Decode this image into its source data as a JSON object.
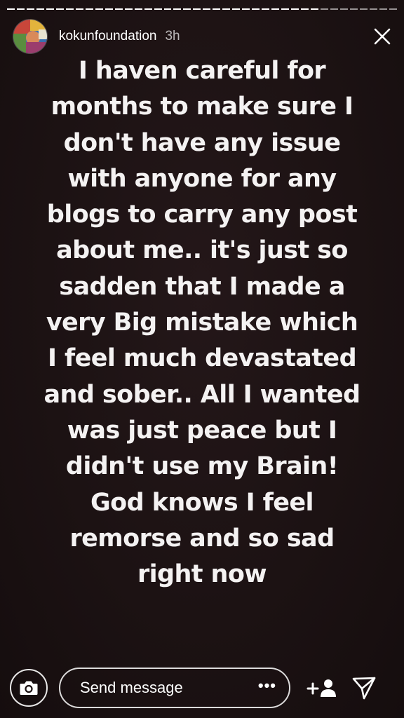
{
  "header": {
    "username": "kokunfoundation",
    "time": "3h"
  },
  "story": {
    "text": "I haven careful for\nmonths to make sure I\ndon't have any issue\nwith anyone for any\nblogs to carry any post\nabout me.. it's just so\nsadden that I made a\nvery Big mistake which\nI feel much devastated\nand sober.. All I wanted\nwas just peace but I\ndidn't use my Brain!\nGod knows I feel\nremorse and so sad\nright now"
  },
  "footer": {
    "message_placeholder": "Send message",
    "more_label": "•••"
  },
  "icons": {
    "close": "close-icon",
    "camera": "camera-icon",
    "add_person": "add-person-icon",
    "send": "paper-plane-icon"
  },
  "colors": {
    "background": "#1c1213",
    "text": "#ffffff"
  }
}
